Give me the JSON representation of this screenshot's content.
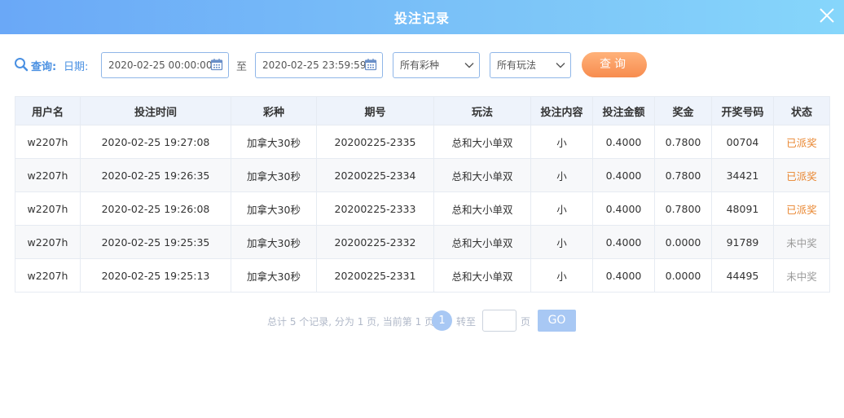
{
  "dialog": {
    "title": "投注记录",
    "close_icon": "close-icon"
  },
  "filter": {
    "query_label": "查询:",
    "date_label": "日期:",
    "start_date": "2020-02-25 00:00:00",
    "to_label": "至",
    "end_date": "2020-02-25 23:59:59",
    "lottery_select": "所有彩种",
    "play_select": "所有玩法",
    "query_button": "查询"
  },
  "table": {
    "headers": [
      "用户名",
      "投注时间",
      "彩种",
      "期号",
      "玩法",
      "投注内容",
      "投注金额",
      "奖金",
      "开奖号码",
      "状态"
    ],
    "rows": [
      [
        "w2207h",
        "2020-02-25 19:27:08",
        "加拿大30秒",
        "20200225-2335",
        "总和大小单双",
        "小",
        "0.4000",
        "0.7800",
        "00704",
        "已派奖"
      ],
      [
        "w2207h",
        "2020-02-25 19:26:35",
        "加拿大30秒",
        "20200225-2334",
        "总和大小单双",
        "小",
        "0.4000",
        "0.7800",
        "34421",
        "已派奖"
      ],
      [
        "w2207h",
        "2020-02-25 19:26:08",
        "加拿大30秒",
        "20200225-2333",
        "总和大小单双",
        "小",
        "0.4000",
        "0.7800",
        "48091",
        "已派奖"
      ],
      [
        "w2207h",
        "2020-02-25 19:25:35",
        "加拿大30秒",
        "20200225-2332",
        "总和大小单双",
        "小",
        "0.4000",
        "0.0000",
        "91789",
        "未中奖"
      ],
      [
        "w2207h",
        "2020-02-25 19:25:13",
        "加拿大30秒",
        "20200225-2331",
        "总和大小单双",
        "小",
        "0.4000",
        "0.0000",
        "44495",
        "未中奖"
      ]
    ]
  },
  "pagination": {
    "summary": "总计 5 个记录, 分为 1 页, 当前第 1 页",
    "current_page": "1",
    "goto_label": "转至",
    "page_input_value": "",
    "page_suffix": "页",
    "go_button": "GO"
  },
  "colors": {
    "header_gradient_start": "#6aa8f7",
    "header_gradient_end": "#86d6fb",
    "accent_blue": "#4a90e2",
    "query_button": "#f78c4f",
    "status_paid": "#e9852e",
    "status_lost": "#999999",
    "pager_active": "#a8c8f4"
  }
}
